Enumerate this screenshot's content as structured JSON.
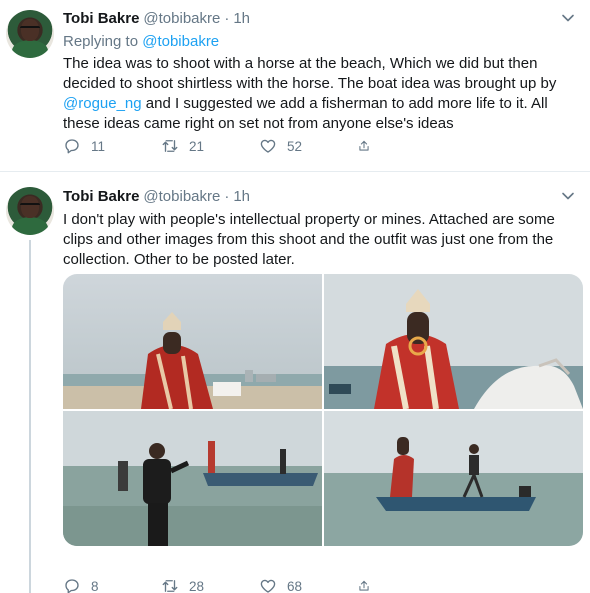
{
  "tweets": [
    {
      "display_name": "Tobi Bakre",
      "handle": "@tobibakre",
      "separator": "·",
      "time": "1h",
      "replying_label": "Replying to",
      "replying_handle": "@tobibakre",
      "text_lines": [
        "The idea was to shoot with a horse at the beach, Which we did but then",
        "decided to shoot shirtless with the horse. The boat idea was brought up by",
        "and I suggested we add a fisherman to add more life to it. All",
        "these ideas came right on set not from anyone else's ideas"
      ],
      "mention": "@rogue_ng",
      "reply_count": "11",
      "retweet_count": "21",
      "like_count": "52"
    },
    {
      "display_name": "Tobi Bakre",
      "handle": "@tobibakre",
      "separator": "·",
      "time": "1h",
      "text_lines": [
        "I don't play with people's intellectual property or mines. Attached are some",
        "clips and other images from this shoot and the outfit was just one from the",
        "collection. Other to be posted later."
      ],
      "reply_count": "8",
      "retweet_count": "28",
      "like_count": "68"
    }
  ],
  "icons": {
    "reply": "reply-icon",
    "retweet": "retweet-icon",
    "like": "heart-icon",
    "share": "share-icon",
    "more": "chevron-down-icon"
  },
  "colors": {
    "link": "#1da1f2",
    "muted": "#657786",
    "divider": "#e6ecf0"
  }
}
